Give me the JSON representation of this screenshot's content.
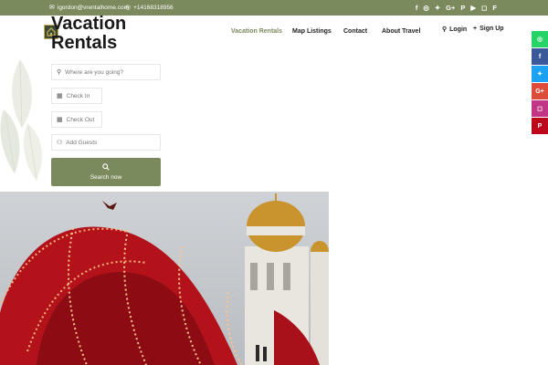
{
  "topbar": {
    "email": "igordon@vrentalhome.com",
    "phone": "+14168318956",
    "email_icon": "envelope-icon",
    "phone_icon": "whatsapp-icon",
    "social": [
      {
        "name": "facebook-icon",
        "glyph": "f"
      },
      {
        "name": "whatsapp-icon",
        "glyph": "◎"
      },
      {
        "name": "twitter-icon",
        "glyph": "✦"
      },
      {
        "name": "google-plus-icon",
        "glyph": "G+"
      },
      {
        "name": "pinterest-icon",
        "glyph": "P"
      },
      {
        "name": "youtube-icon",
        "glyph": "▶"
      },
      {
        "name": "instagram-icon",
        "glyph": "◻"
      },
      {
        "name": "foursquare-icon",
        "glyph": "F"
      }
    ]
  },
  "header": {
    "brand": "Vacation Rentals",
    "nav": [
      "Vacation Rentals",
      "Map Listings",
      "Contact",
      "About Travel"
    ],
    "login": "Login",
    "signup": "Sign Up"
  },
  "search": {
    "destination_placeholder": "Where are you going?",
    "checkin_placeholder": "Check In",
    "checkout_placeholder": "Check Out",
    "guests_placeholder": "Add Guests",
    "button_label": "Search now"
  },
  "float_social": [
    {
      "name": "whatsapp-icon",
      "glyph": "◎",
      "color": "#25d366"
    },
    {
      "name": "facebook-icon",
      "glyph": "f",
      "color": "#3b5998"
    },
    {
      "name": "twitter-icon",
      "glyph": "✦",
      "color": "#1da1f2"
    },
    {
      "name": "google-plus-icon",
      "glyph": "G+",
      "color": "#dd4b39"
    },
    {
      "name": "instagram-icon",
      "glyph": "◻",
      "color": "#c13584"
    },
    {
      "name": "pinterest-icon",
      "glyph": "P",
      "color": "#bd081c"
    }
  ],
  "colors": {
    "accent": "#7a8a5c",
    "logo_bg": "#3d4a34",
    "logo_border": "#c9b25a"
  }
}
